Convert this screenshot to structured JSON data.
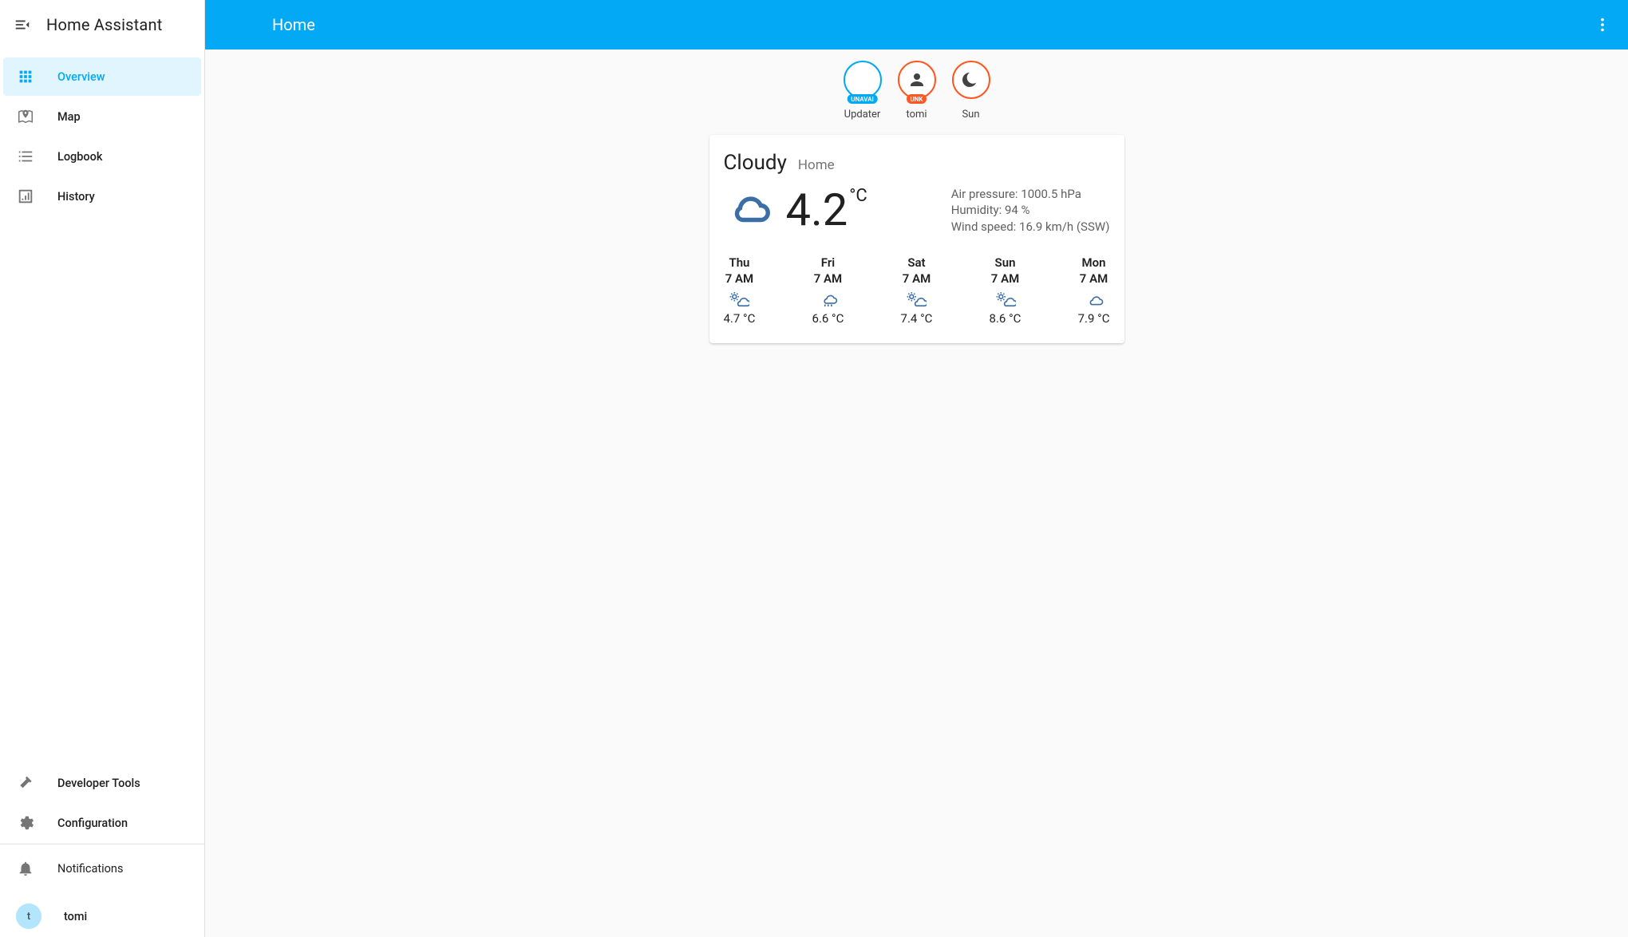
{
  "sidebar": {
    "title": "Home Assistant",
    "items": [
      {
        "id": "overview",
        "label": "Overview",
        "icon": "grid",
        "active": true
      },
      {
        "id": "map",
        "label": "Map",
        "icon": "map"
      },
      {
        "id": "logbook",
        "label": "Logbook",
        "icon": "list"
      },
      {
        "id": "history",
        "label": "History",
        "icon": "chart"
      }
    ],
    "tools": [
      {
        "id": "devtools",
        "label": "Developer Tools",
        "icon": "hammer"
      },
      {
        "id": "config",
        "label": "Configuration",
        "icon": "gear"
      }
    ],
    "bottom": [
      {
        "id": "notifications",
        "label": "Notifications",
        "icon": "bell"
      }
    ],
    "user": {
      "initial": "t",
      "name": "tomi"
    }
  },
  "header": {
    "tabs": [
      {
        "label": "Home"
      }
    ]
  },
  "badges": [
    {
      "id": "updater",
      "label": "Updater",
      "ring": "blue",
      "chip": "UNAVAI",
      "chip_color": "blue",
      "icon": ""
    },
    {
      "id": "tomi",
      "label": "tomi",
      "ring": "orange",
      "chip": "UNK",
      "chip_color": "orange",
      "icon": "person"
    },
    {
      "id": "sun",
      "label": "Sun",
      "ring": "orange",
      "chip": "",
      "chip_color": "",
      "icon": "moon"
    }
  ],
  "weather": {
    "condition": "Cloudy",
    "location": "Home",
    "temp": "4.2",
    "unit": "°C",
    "attrs": {
      "pressure_label": "Air pressure: 1000.5 hPa",
      "humidity_label": "Humidity: 94 %",
      "wind_label": "Wind speed: 16.9 km/h (SSW)"
    },
    "forecast": [
      {
        "day": "Thu",
        "time": "7 AM",
        "icon": "partly",
        "temp": "4.7 °C"
      },
      {
        "day": "Fri",
        "time": "7 AM",
        "icon": "rainy",
        "temp": "6.6 °C"
      },
      {
        "day": "Sat",
        "time": "7 AM",
        "icon": "partly",
        "temp": "7.4 °C"
      },
      {
        "day": "Sun",
        "time": "7 AM",
        "icon": "partly",
        "temp": "8.6 °C"
      },
      {
        "day": "Mon",
        "time": "7 AM",
        "icon": "cloudy",
        "temp": "7.9 °C"
      }
    ]
  }
}
